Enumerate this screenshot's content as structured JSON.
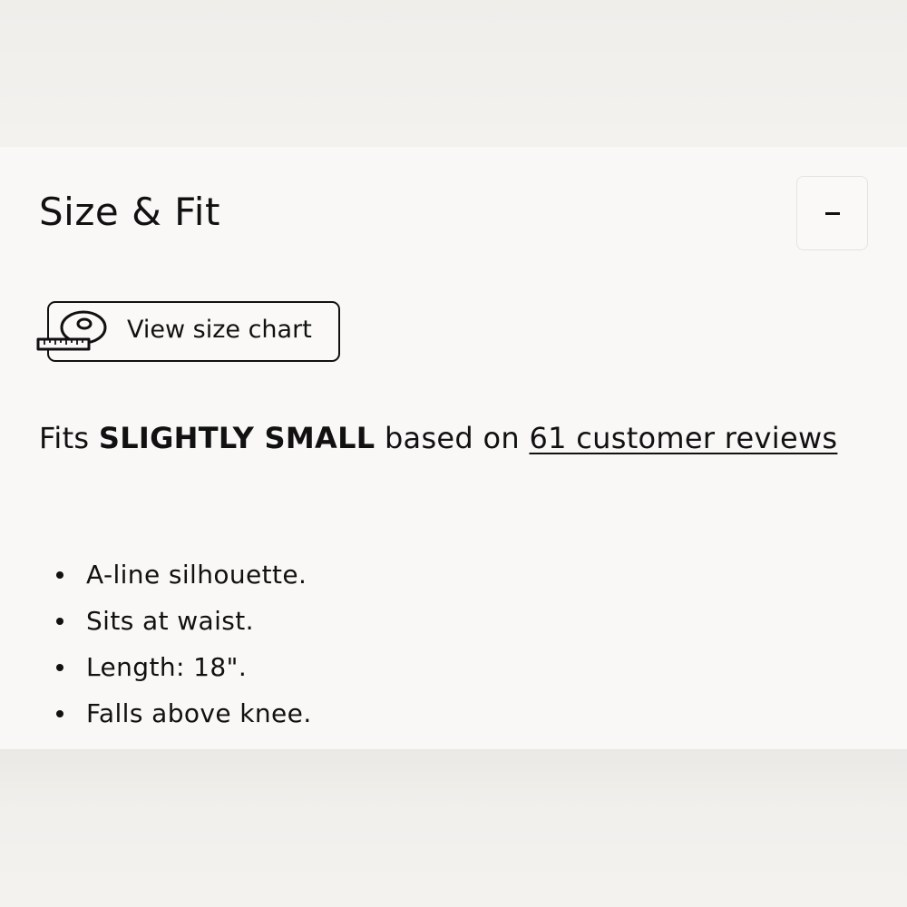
{
  "section": {
    "title": "Size & Fit",
    "toggle_label": "-"
  },
  "size_chart": {
    "label": "View size chart",
    "icon": "measuring-tape-icon"
  },
  "fit": {
    "prefix": "Fits",
    "rating": "SLIGHTLY SMALL",
    "middle": "based on",
    "reviews_link": "61 customer reviews"
  },
  "details": [
    "A-line silhouette.",
    "Sits at waist.",
    "Length: 18\".",
    "Falls above knee."
  ]
}
